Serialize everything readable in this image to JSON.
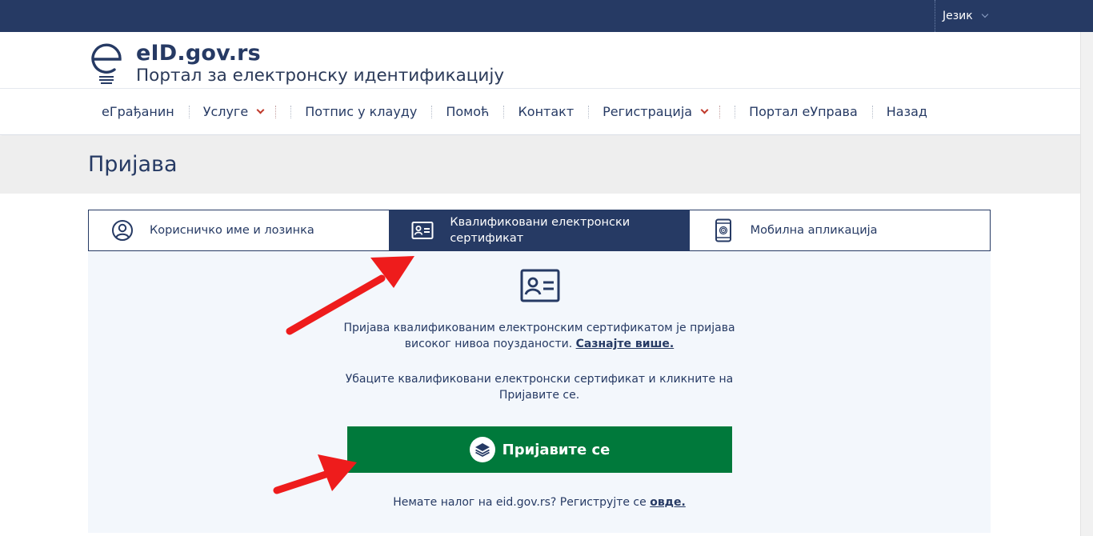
{
  "topbar": {
    "language_label": "Језик"
  },
  "header": {
    "site_title": "eID.gov.rs",
    "site_subtitle": "Портал за електронску идентификацију"
  },
  "nav": {
    "items": [
      {
        "label": "еГрађанин"
      },
      {
        "label": "Услуге"
      },
      {
        "label": "Потпис у клауду"
      },
      {
        "label": "Помоћ"
      },
      {
        "label": "Контакт"
      },
      {
        "label": "Регистрација"
      },
      {
        "label": "Портал еУправа"
      },
      {
        "label": "Назад"
      }
    ]
  },
  "page": {
    "title": "Пријава"
  },
  "tabs": [
    {
      "label": "Корисничко име и лозинка",
      "icon": "user-circle-icon",
      "active": false
    },
    {
      "label_line1": "Квалификовани електронски",
      "label_line2": "сертификат",
      "icon": "id-card-icon",
      "active": true
    },
    {
      "label": "Мобилна апликација",
      "icon": "mobile-phone-icon",
      "active": false
    }
  ],
  "panel": {
    "intro_text": "Пријава квалификованим електронским сертификатом је пријава високог нивоа поузданости.",
    "learn_more": "Сазнајте више.",
    "instruction": "Убаците квалификовани електронски сертификат и кликните на Пријавите се.",
    "login_button": "Пријавите се",
    "register_text": "Немате налог на eid.gov.rs? Региструјте се",
    "register_link": "овде."
  },
  "colors": {
    "navy": "#263a64",
    "green": "#00793b",
    "panel_bg": "#f3f7fc",
    "arrow_red": "#ee1c1c"
  }
}
